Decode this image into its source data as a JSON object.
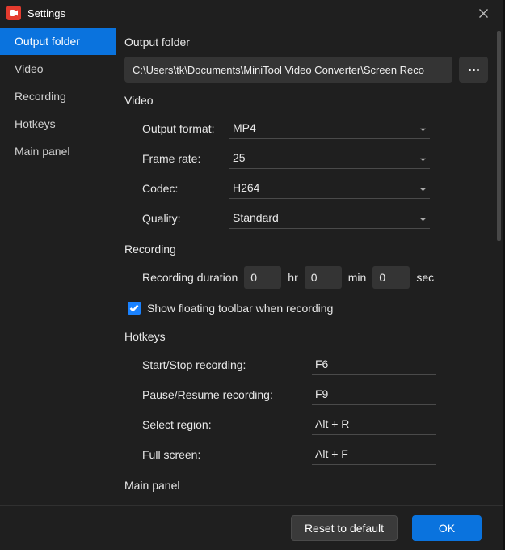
{
  "title": "Settings",
  "sidebar": {
    "items": [
      {
        "label": "Output folder",
        "active": true
      },
      {
        "label": "Video",
        "active": false
      },
      {
        "label": "Recording",
        "active": false
      },
      {
        "label": "Hotkeys",
        "active": false
      },
      {
        "label": "Main panel",
        "active": false
      }
    ]
  },
  "output": {
    "heading": "Output folder",
    "path": "C:\\Users\\tk\\Documents\\MiniTool Video Converter\\Screen Reco"
  },
  "video": {
    "heading": "Video",
    "format_label": "Output format:",
    "format_value": "MP4",
    "framerate_label": "Frame rate:",
    "framerate_value": "25",
    "codec_label": "Codec:",
    "codec_value": "H264",
    "quality_label": "Quality:",
    "quality_value": "Standard"
  },
  "recording": {
    "heading": "Recording",
    "duration_label": "Recording duration",
    "hr_value": "0",
    "hr_unit": "hr",
    "min_value": "0",
    "min_unit": "min",
    "sec_value": "0",
    "sec_unit": "sec",
    "show_toolbar_checked": true,
    "show_toolbar_label": "Show floating toolbar when recording"
  },
  "hotkeys": {
    "heading": "Hotkeys",
    "start_label": "Start/Stop recording:",
    "start_value": "F6",
    "pause_label": "Pause/Resume recording:",
    "pause_value": "F9",
    "region_label": "Select region:",
    "region_value": "Alt + R",
    "full_label": "Full screen:",
    "full_value": "Alt + F"
  },
  "mainpanel": {
    "heading": "Main panel"
  },
  "footer": {
    "reset": "Reset to default",
    "ok": "OK"
  }
}
